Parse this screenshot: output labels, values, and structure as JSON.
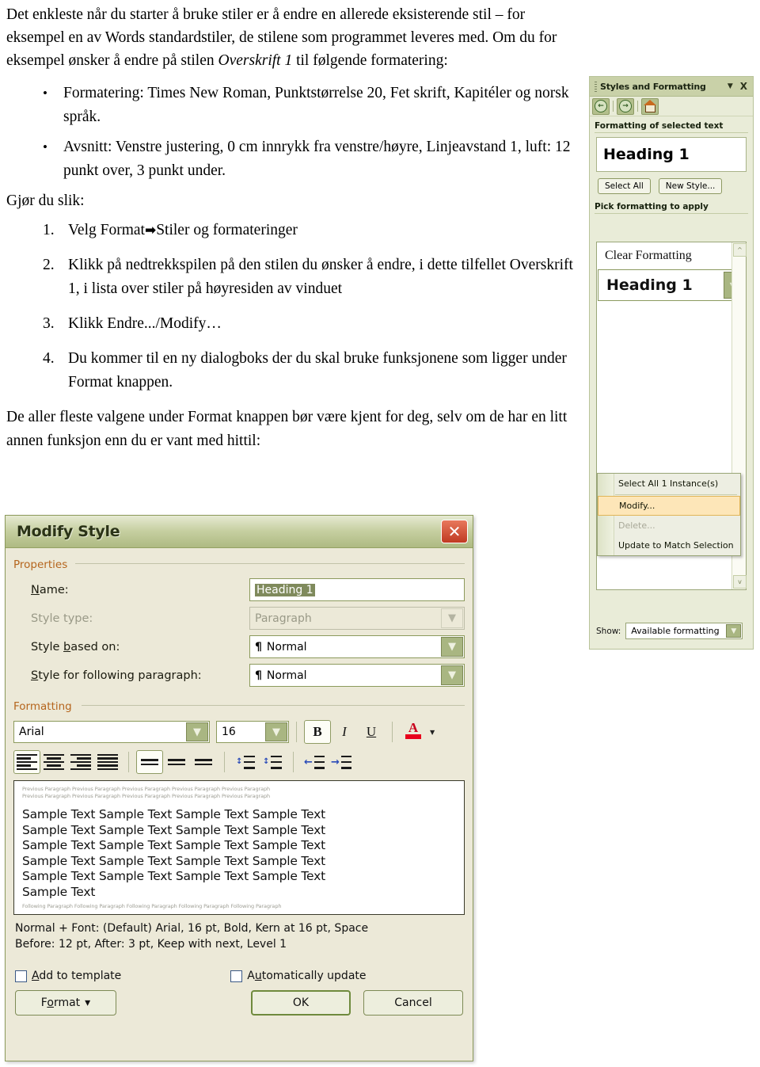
{
  "document": {
    "paragraph1_a": "Det enkleste når du starter å bruke stiler er å endre en allerede eksisterende stil – for eksempel en av Words standardstiler, de stilene som programmet leveres med. Om du for eksempel ønsker å endre på stilen ",
    "paragraph1_italic": "Overskrift 1",
    "paragraph1_b": " til følgende formatering:",
    "bullets": [
      "Formatering: Times New Roman, Punktstørrelse 20, Fet skrift, Kapitéler og norsk språk.",
      "Avsnitt: Venstre justering, 0 cm innrykk fra venstre/høyre, Linjeavstand 1, luft: 12 punkt over, 3 punkt under."
    ],
    "gjor_du_slik": "Gjør du slik:",
    "steps": [
      "Velg Format→Stiler og formateringer",
      "Klikk på nedtrekkspilen på den stilen du ønsker å endre, i dette tilfellet Overskrift 1, i lista over stiler på høyresiden av vinduet",
      "Klikk Endre.../Modify…",
      "Du kommer til en ny dialogboks der du skal bruke funksjonene som ligger under Format knappen."
    ],
    "step1_pre": "Velg Format",
    "step1_post": "Stiler og formateringer",
    "closing": "De aller fleste valgene under Format knappen bør være kjent for deg, selv om de har en litt annen funksjon enn du er vant med hittil:"
  },
  "task_pane": {
    "title": "Styles and Formatting",
    "caret_icon": "▼",
    "close_icon": "X",
    "nav": {
      "back_icon": "◄",
      "forward_icon": "►",
      "home_icon": "home-icon"
    },
    "section1_label": "Formatting of selected text",
    "selected_style": "Heading 1",
    "select_all_button": "Select All",
    "new_style_button": "New Style...",
    "section2_label": "Pick formatting to apply",
    "list_items": [
      {
        "label": "Clear Formatting",
        "style": "serif"
      },
      {
        "label": "Heading 1",
        "style": "heading"
      }
    ],
    "context_menu": [
      {
        "label": "Select All 1 Instance(s)",
        "state": "normal",
        "underline": "S"
      },
      {
        "label": "Modify...",
        "state": "highlighted",
        "underline": "M"
      },
      {
        "label": "Delete...",
        "state": "disabled",
        "underline": "D"
      },
      {
        "label": "Update to Match Selection",
        "state": "normal",
        "underline": "U"
      }
    ],
    "show_label": "Show:",
    "show_value": "Available formatting",
    "scroll_up_icon": "^",
    "scroll_down_icon": "v"
  },
  "modify_dialog": {
    "title": "Modify Style",
    "close_icon": "✕",
    "properties_group": "Properties",
    "fields": [
      {
        "label": "Name:",
        "value": "Heading 1",
        "type": "text",
        "disabled": false
      },
      {
        "label": "Style type:",
        "value": "Paragraph",
        "type": "combo",
        "disabled": true
      },
      {
        "label": "Style based on:",
        "value": "Normal",
        "type": "combo",
        "disabled": false,
        "pilcrow": "¶"
      },
      {
        "label": "Style for following paragraph:",
        "value": "Normal",
        "type": "combo",
        "disabled": false,
        "pilcrow": "¶"
      }
    ],
    "formatting_group": "Formatting",
    "font_name": "Arial",
    "font_size": "16",
    "bold_label": "B",
    "italic_label": "I",
    "underline_label": "U",
    "font_color_label": "A",
    "font_color_hex": "#e8001c",
    "preview": {
      "previous_paragraph_line": "Previous Paragraph Previous Paragraph Previous Paragraph Previous Paragraph Previous Paragraph",
      "sample_line": "Sample Text Sample Text Sample Text Sample Text",
      "sample_last": "Sample Text",
      "following_paragraph_line": "Following Paragraph Following Paragraph Following Paragraph Following Paragraph Following Paragraph"
    },
    "description_line1": "Normal + Font: (Default) Arial, 16 pt, Bold, Kern at 16 pt, Space",
    "description_line2": "Before:  12 pt, After:  3 pt, Keep with next, Level 1",
    "add_to_template_label": "Add to template",
    "automatically_update_label": "Automatically update",
    "format_button": "Format",
    "format_caret": "▾",
    "ok_button": "OK",
    "cancel_button": "Cancel"
  },
  "colors": {
    "pane_bg": "#e9ecd8",
    "pane_title_bg": "#c9d1a8",
    "dialog_bg": "#ece9d8",
    "dialog_border": "#8c9a5c",
    "group_label": "#b5651d",
    "highlight": "#fde6b8",
    "close_red": "#c03a22"
  }
}
